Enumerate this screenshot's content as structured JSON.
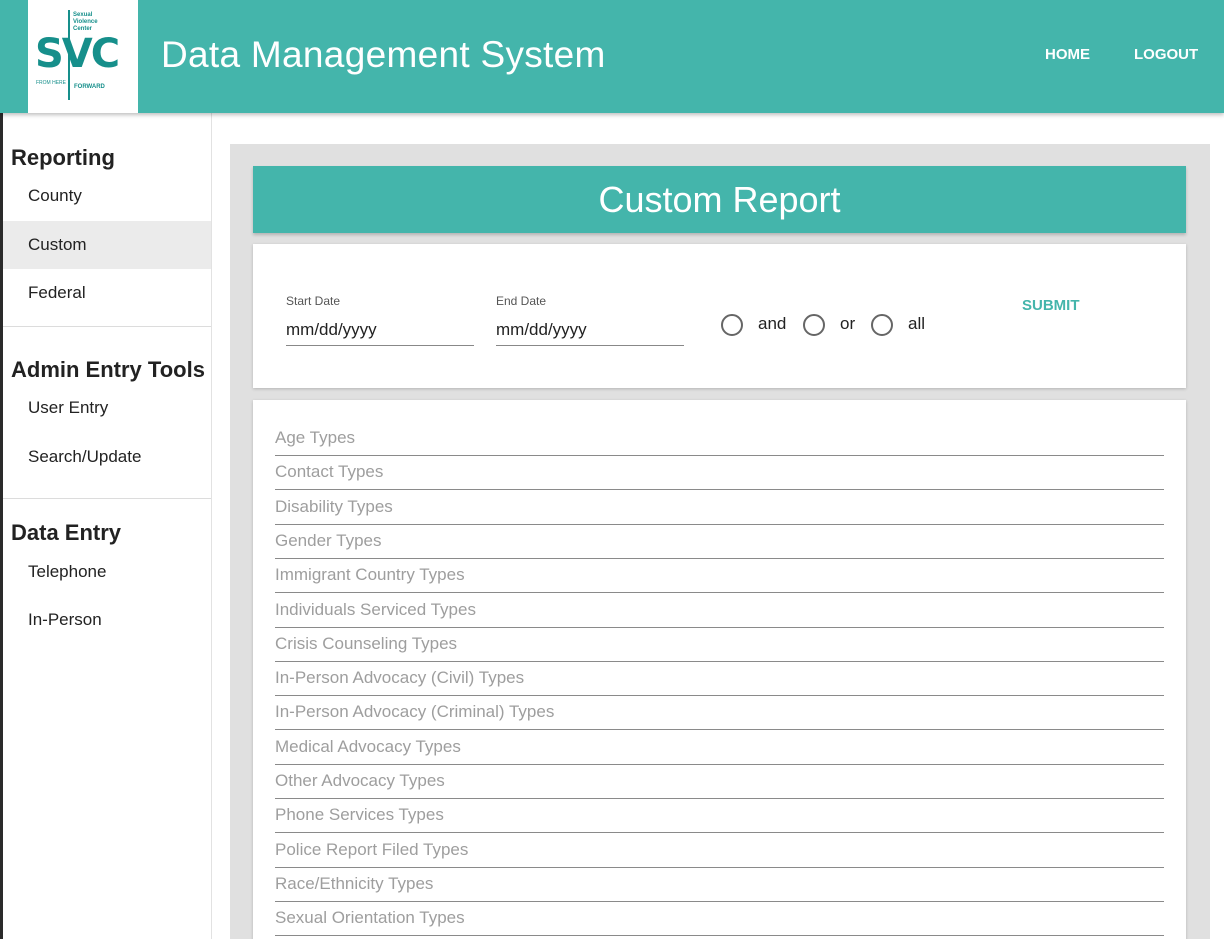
{
  "logo": {
    "wordmark": "SVC",
    "org_lines": [
      "Sexual",
      "Violence",
      "Center"
    ],
    "tagline_left": "FROM HERE",
    "tagline_right": "FORWARD"
  },
  "header": {
    "title": "Data Management System",
    "nav": [
      "HOME",
      "LOGOUT"
    ]
  },
  "sidebar": {
    "sections": [
      {
        "title": "Reporting",
        "items": [
          "County",
          "Custom",
          "Federal"
        ]
      },
      {
        "title": "Admin Entry Tools",
        "items": [
          "User Entry",
          "Search/Update"
        ]
      },
      {
        "title": "Data Entry",
        "items": [
          "Telephone",
          "In-Person"
        ]
      }
    ],
    "active_item": "Custom"
  },
  "report": {
    "title": "Custom Report",
    "start_date_label": "Start Date",
    "start_date_placeholder": "mm/dd/yyyy",
    "end_date_label": "End Date",
    "end_date_placeholder": "mm/dd/yyyy",
    "options": [
      "and",
      "or",
      "all"
    ],
    "submit_label": "SUBMIT"
  },
  "types": [
    "Age Types",
    "Contact Types",
    "Disability Types",
    "Gender Types",
    "Immigrant Country Types",
    "Individuals Serviced Types",
    "Crisis Counseling Types",
    "In-Person Advocacy (Civil) Types",
    "In-Person Advocacy (Criminal) Types",
    "Medical Advocacy Types",
    "Other Advocacy Types",
    "Phone Services Types",
    "Police Report Filed Types",
    "Race/Ethnicity Types",
    "Sexual Orientation Types"
  ],
  "colors": {
    "brand_teal": "#44b5ab",
    "logo_teal": "#168f8b"
  }
}
